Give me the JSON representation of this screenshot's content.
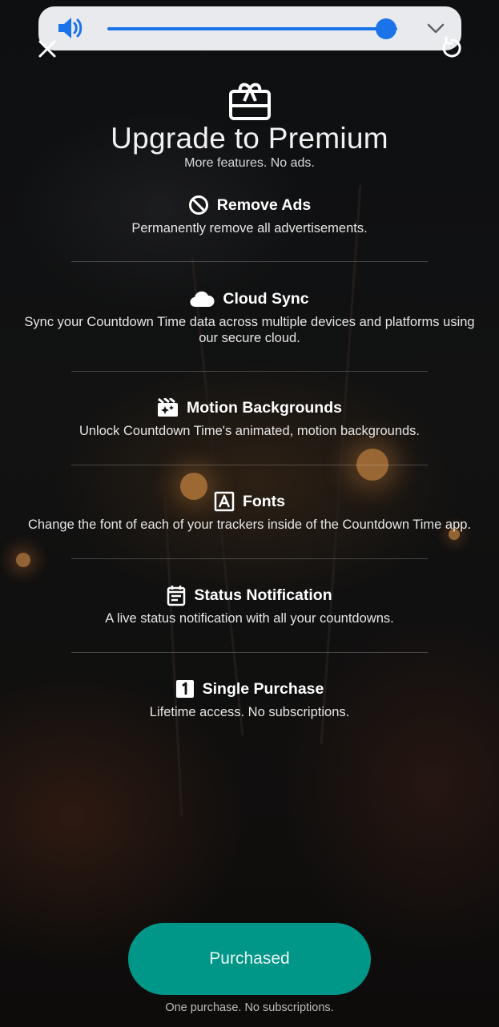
{
  "volume": {
    "level_percent": 96,
    "accent_color": "#1a73e8",
    "speaker_icon": "speaker-icon",
    "expand_icon": "chevron-down-icon"
  },
  "toolbar": {
    "close_icon": "close-icon",
    "restore_icon": "restore-icon"
  },
  "header": {
    "icon": "gift-card-icon",
    "title": "Upgrade to Premium",
    "subtitle": "More features. No ads."
  },
  "features": [
    {
      "icon": "block-icon",
      "title": "Remove Ads",
      "description": "Permanently remove all advertisements."
    },
    {
      "icon": "cloud-icon",
      "title": "Cloud Sync",
      "description": "Sync your Countdown Time data across multiple devices and platforms using our secure cloud."
    },
    {
      "icon": "motion-video-icon",
      "title": "Motion Backgrounds",
      "description": "Unlock Countdown Time's animated, motion backgrounds."
    },
    {
      "icon": "font-icon",
      "title": "Fonts",
      "description": "Change the font of each of your trackers inside of the Countdown Time app."
    },
    {
      "icon": "calendar-icon",
      "title": "Status Notification",
      "description": "A live status notification with all your countdowns."
    },
    {
      "icon": "one-box-icon",
      "title": "Single Purchase",
      "description": "Lifetime access. No subscriptions."
    }
  ],
  "purchase": {
    "button_label": "Purchased",
    "button_color": "#009688",
    "footnote": "One purchase. No subscriptions."
  }
}
